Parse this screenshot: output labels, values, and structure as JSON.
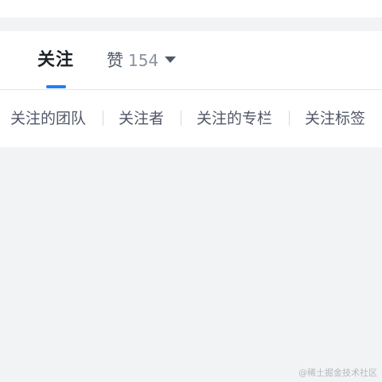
{
  "tabs": {
    "follow_label": "关注",
    "like_label": "赞",
    "like_count": "154"
  },
  "subnav": {
    "items": [
      "关注的团队",
      "关注者",
      "关注的专栏",
      "关注标签"
    ]
  },
  "watermark": "@稀土掘金技术社区"
}
